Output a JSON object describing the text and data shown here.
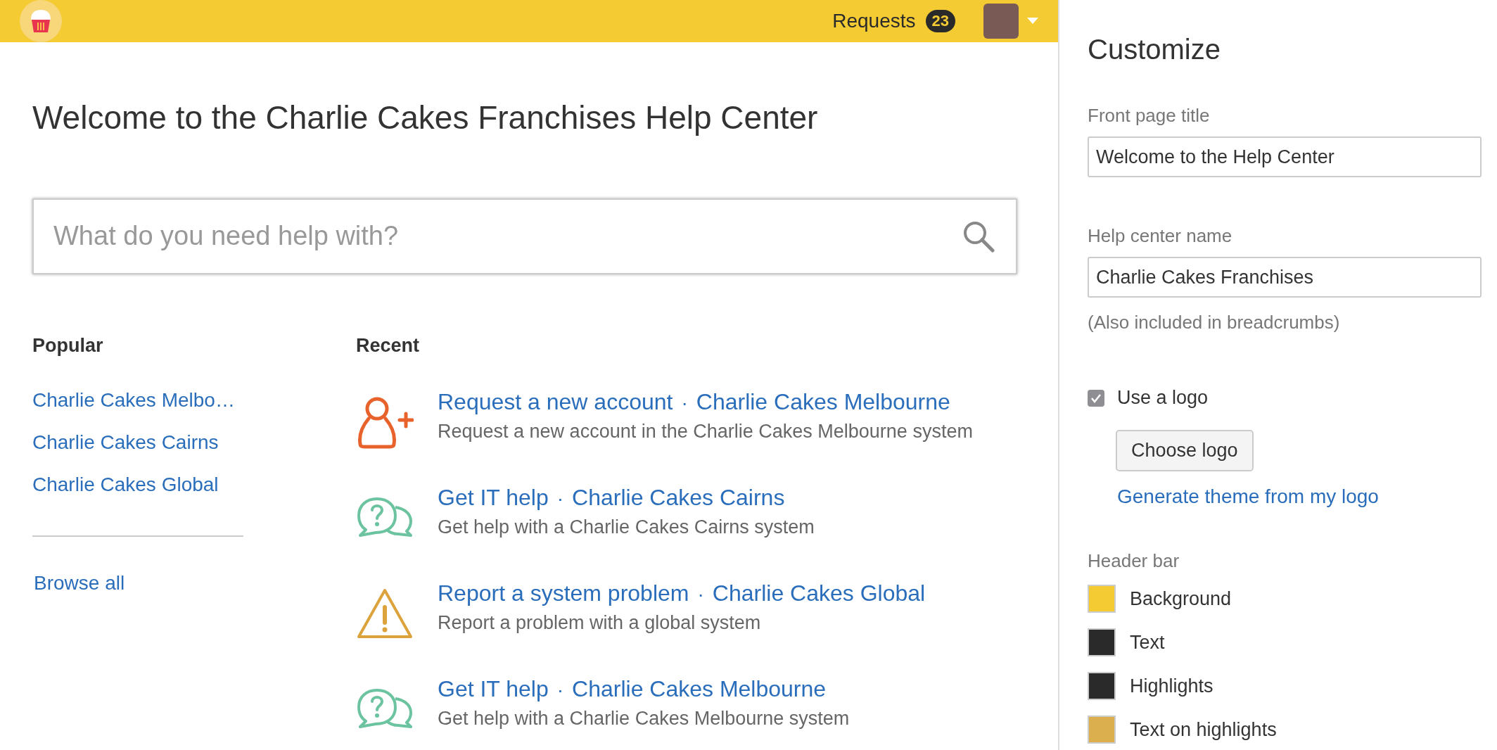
{
  "header": {
    "requests_label": "Requests",
    "requests_count": "23"
  },
  "title": "Welcome to the Charlie Cakes Franchises Help Center",
  "search": {
    "placeholder": "What do you need help with?"
  },
  "popular": {
    "heading": "Popular",
    "items": [
      "Charlie Cakes Melbo…",
      "Charlie Cakes Cairns",
      "Charlie Cakes Global"
    ],
    "browse_all": "Browse all"
  },
  "recent": {
    "heading": "Recent",
    "separator": "·",
    "items": [
      {
        "kind": "account",
        "title": "Request a new account",
        "project": "Charlie Cakes Melbourne",
        "description": "Request a new account in the Charlie Cakes Melbourne system"
      },
      {
        "kind": "help",
        "title": "Get IT help",
        "project": "Charlie Cakes Cairns",
        "description": "Get help with a Charlie Cakes Cairns system"
      },
      {
        "kind": "problem",
        "title": "Report a system problem",
        "project": "Charlie Cakes Global",
        "description": "Report a problem with a global system"
      },
      {
        "kind": "help",
        "title": "Get IT help",
        "project": "Charlie Cakes Melbourne",
        "description": "Get help with a Charlie Cakes Melbourne system"
      }
    ]
  },
  "customize": {
    "heading": "Customize",
    "front_page_title": {
      "label": "Front page title",
      "value": "Welcome to the Help Center"
    },
    "help_center_name": {
      "label": "Help center name",
      "value": "Charlie Cakes Franchises",
      "note": "(Also included in breadcrumbs)"
    },
    "use_logo": {
      "label": "Use a logo",
      "checked": true
    },
    "choose_logo": "Choose logo",
    "generate_theme": "Generate theme from my logo",
    "header_bar": {
      "heading": "Header bar",
      "swatches": [
        {
          "label": "Background",
          "color": "#f4cb32"
        },
        {
          "label": "Text",
          "color": "#2a2a2a"
        },
        {
          "label": "Highlights",
          "color": "#2a2a2a"
        },
        {
          "label": "Text on highlights",
          "color": "#dcaf4e"
        }
      ]
    }
  }
}
